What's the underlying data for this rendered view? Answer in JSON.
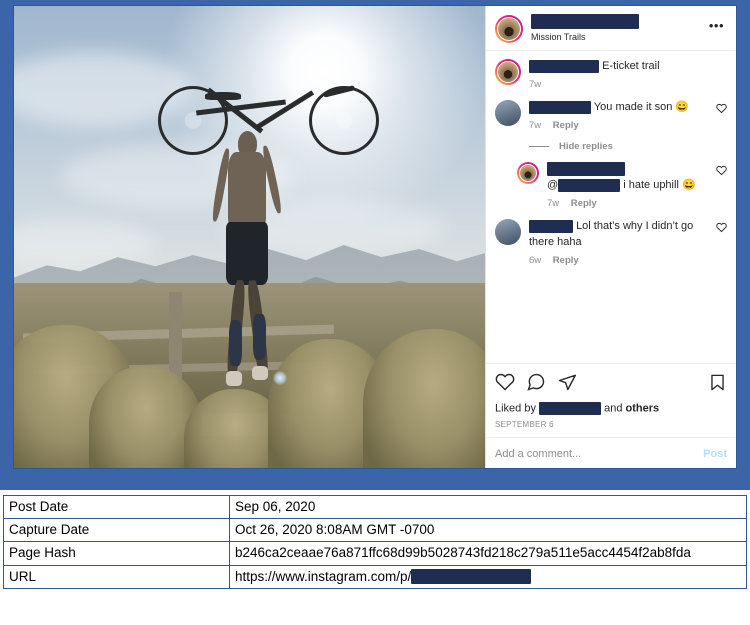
{
  "capture": {
    "photo": {
      "alt": "Mountain biker standing on a fence rail holding a bicycle overhead at sunset with mountains behind"
    },
    "instagram": {
      "header": {
        "username_redacted": true,
        "location": "Mission Trails",
        "more_options": "•••"
      },
      "caption": {
        "username_redacted": true,
        "text": "E-ticket trail",
        "time": "7w"
      },
      "comments": [
        {
          "username_redacted": true,
          "text": "You made it son",
          "emoji": "😄",
          "time": "7w",
          "reply_label": "Reply",
          "avatar_style": "plain",
          "hide_replies_label": "Hide replies",
          "replies": [
            {
              "username_redacted": true,
              "mention_redacted": true,
              "mention_prefix": "@",
              "text": "i hate uphill",
              "emoji": "😄",
              "time": "7w",
              "reply_label": "Reply",
              "avatar_style": "ring"
            }
          ]
        },
        {
          "username_redacted": true,
          "text": "Lol that’s why I didn’t go there haha",
          "time": "6w",
          "reply_label": "Reply",
          "avatar_style": "plain",
          "replies": []
        }
      ],
      "actions": {
        "like": "like-icon",
        "comment": "comment-icon",
        "share": "share-icon",
        "save": "bookmark-icon"
      },
      "likes": {
        "prefix": "Liked by",
        "user_redacted": true,
        "suffix_and": "and",
        "suffix_others": "others"
      },
      "post_date_label": "SEPTEMBER 6",
      "add_comment": {
        "placeholder": "Add a comment...",
        "post_label": "Post"
      }
    }
  },
  "metadata": {
    "rows": [
      {
        "key": "Post Date",
        "value": "Sep 06, 2020"
      },
      {
        "key": "Capture Date",
        "value": "Oct 26, 2020 8:08AM GMT -0700"
      },
      {
        "key": "Page Hash",
        "value": "b246ca2ceaae76a871ffc68d99b5028743fd218c279a511e5acc4454f2ab8fda"
      },
      {
        "key": "URL",
        "value": "https://www.instagram.com/p/"
      }
    ]
  },
  "colors": {
    "frame_blue": "#3b65a8",
    "table_border": "#2f569a",
    "redaction": "#1f2d50",
    "ig_text": "#262626",
    "ig_muted": "#8e8e8e",
    "post_disabled": "#b2dffc"
  }
}
